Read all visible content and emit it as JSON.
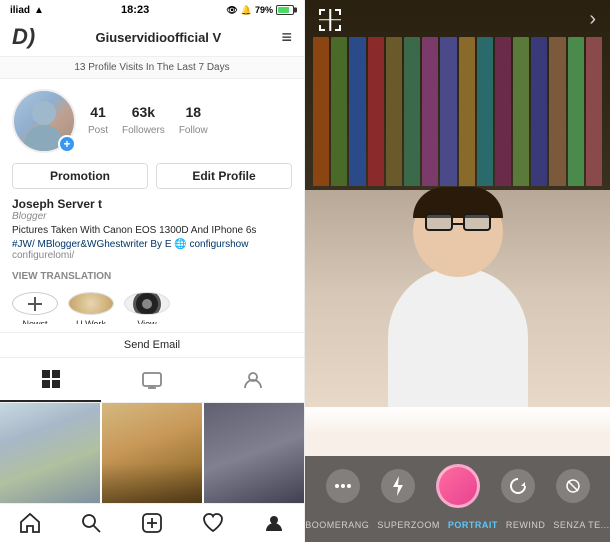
{
  "left": {
    "statusBar": {
      "carrier": "iliad",
      "signal": "▲",
      "time": "18:23",
      "icons": [
        "eye-icon",
        "volume-icon"
      ],
      "battery": "79%"
    },
    "nav": {
      "logo": "D)",
      "username": "Giuservidioofficial V",
      "menuIcon": "≡"
    },
    "visitsBanner": "13 Profile Visits In The Last 7 Days",
    "stats": {
      "posts": {
        "value": "41",
        "label": "Post"
      },
      "followers": {
        "value": "63k",
        "label": "Followers"
      },
      "following": {
        "value": "18",
        "label": "Follow"
      }
    },
    "buttons": {
      "promotion": "Promotion",
      "editProfile": "Edit Profile"
    },
    "profile": {
      "name": "Joseph Server t",
      "bioTitle": "Blogger",
      "bio": "Pictures Taken With Canon EOS 1300D And IPhone 6s",
      "hashtag": "#JW/ MBlogger&WGhestwriter By E 🌐 configurshow",
      "link": "configurelomi/"
    },
    "viewTranslation": "VIEW TRANSLATION",
    "highlights": [
      {
        "label": "Newst",
        "type": "add"
      },
      {
        "label": "U Work",
        "type": "granola"
      },
      {
        "label": "View",
        "type": "lens"
      }
    ],
    "sendEmail": "Send Email",
    "tabs": {
      "grid": "⊞",
      "tv": "▭",
      "user": "👤"
    },
    "photos": [
      {
        "id": 1,
        "type": "nature"
      },
      {
        "id": 2,
        "type": "city"
      },
      {
        "id": 3,
        "type": "dark"
      }
    ],
    "bottomNav": [
      {
        "label": "home",
        "icon": "🏠"
      },
      {
        "label": "search",
        "icon": "🔍"
      },
      {
        "label": "add",
        "icon": "➕"
      },
      {
        "label": "heart",
        "icon": "♡"
      },
      {
        "label": "profile",
        "icon": "👤"
      }
    ]
  },
  "right": {
    "crosshair": "crosshair",
    "chevron": ">",
    "cameraIcons": [
      "dots",
      "lightning",
      "record",
      "rewind",
      "nofilter"
    ],
    "modes": [
      {
        "label": "BOOMERANG",
        "active": false
      },
      {
        "label": "SUPERZOOM",
        "active": false
      },
      {
        "label": "PORTRAIT",
        "active": true
      },
      {
        "label": "REWIND",
        "active": false
      },
      {
        "label": "SENZA TE...",
        "active": false
      }
    ]
  }
}
